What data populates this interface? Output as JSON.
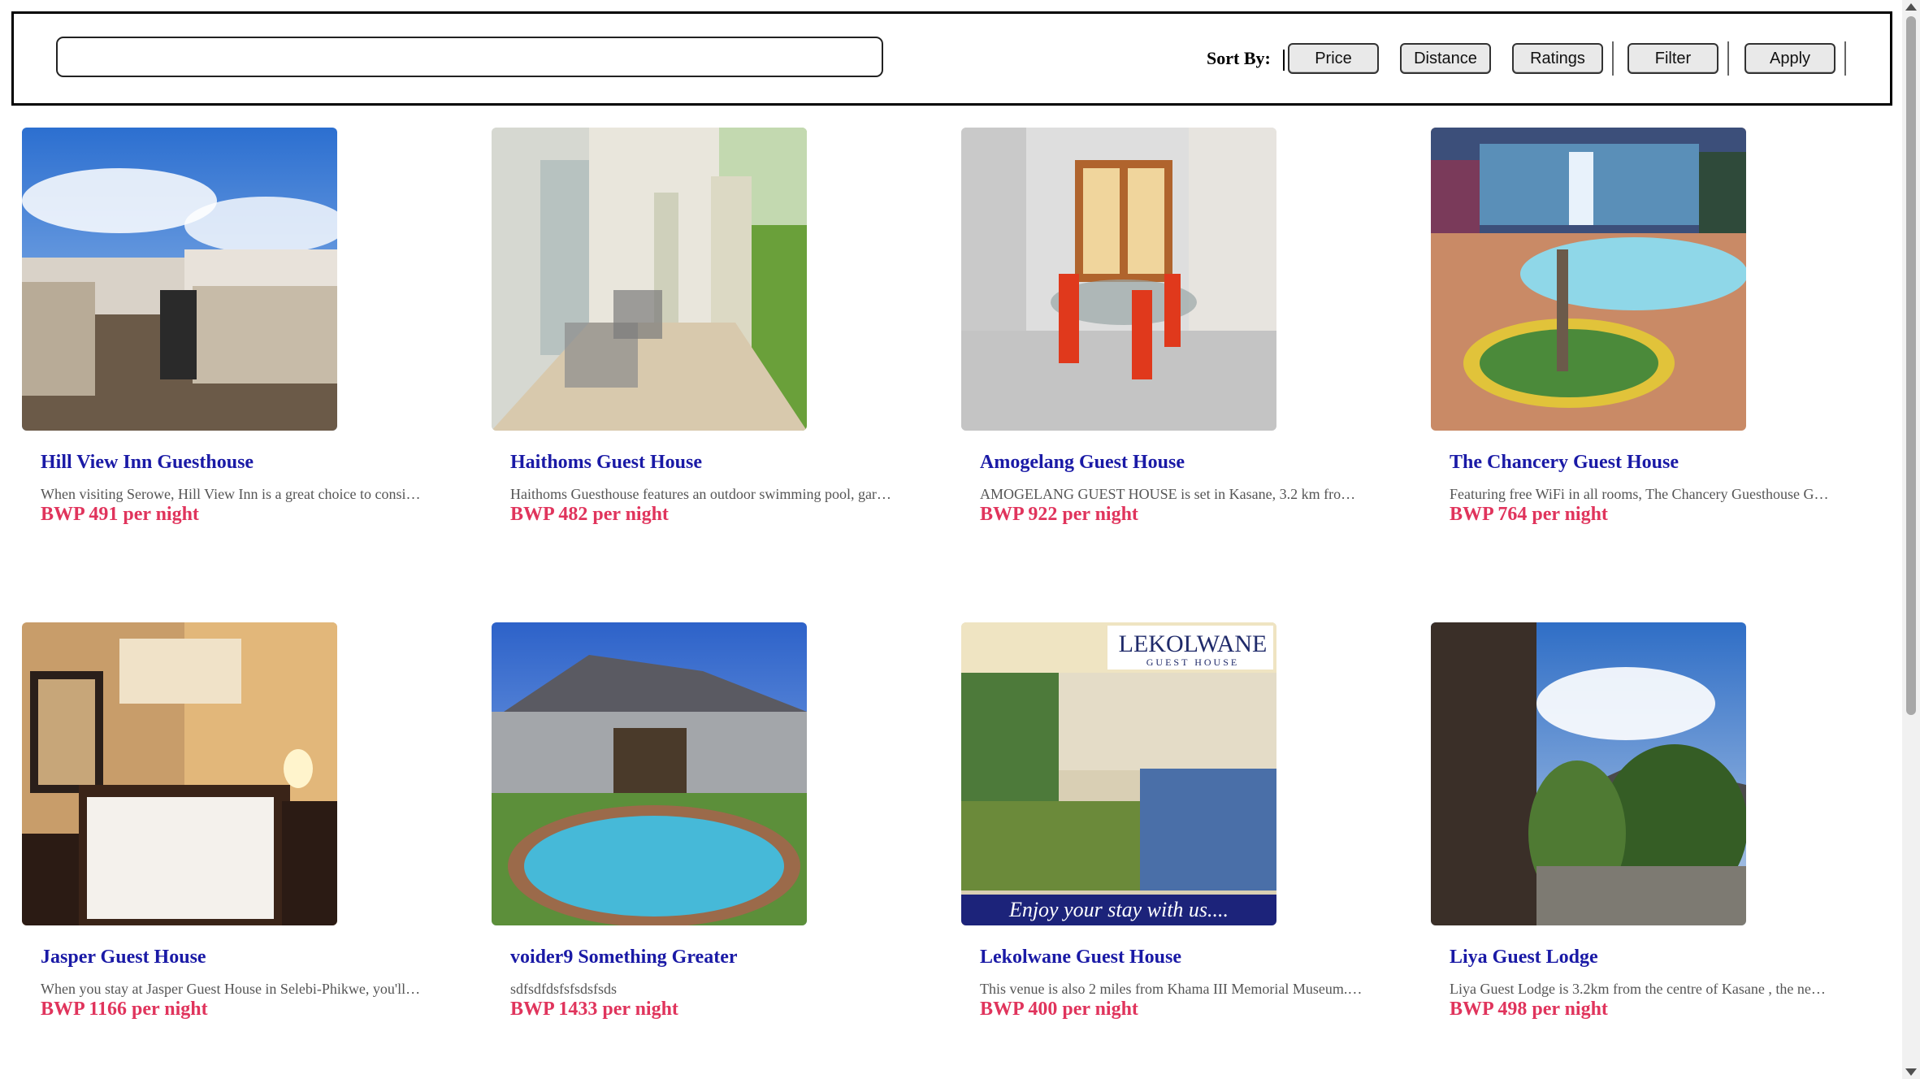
{
  "search": {
    "value": "",
    "placeholder": ""
  },
  "toolbar": {
    "sort_label": "Sort By:",
    "buttons": {
      "price": "Price",
      "distance": "Distance",
      "ratings": "Ratings",
      "filter": "Filter",
      "apply": "Apply"
    }
  },
  "listings": [
    {
      "title": "Hill View Inn Guesthouse",
      "description": "When visiting Serowe, Hill View Inn is a great choice to consi…",
      "price": "BWP 491 per night"
    },
    {
      "title": "Haithoms Guest House",
      "description": "Haithoms Guesthouse features an outdoor swimming pool, gar…",
      "price": "BWP 482 per night"
    },
    {
      "title": "Amogelang Guest House",
      "description": "AMOGELANG GUEST HOUSE is set in Kasane, 3.2 km fro…",
      "price": "BWP 922 per night"
    },
    {
      "title": "The Chancery Guest House",
      "description": "Featuring free WiFi in all rooms, The Chancery Guesthouse G…",
      "price": "BWP 764 per night"
    },
    {
      "title": "Jasper Guest House",
      "description": "When you stay at Jasper Guest House in Selebi-Phikwe, you'll…",
      "price": "BWP 1166 per night"
    },
    {
      "title": "voider9 Something Greater",
      "description": "sdfsdfdsfsfsdsfsds",
      "price": "BWP 1433 per night"
    },
    {
      "title": "Lekolwane Guest House",
      "description": "This venue is also 2 miles from Khama III Memorial Museum.…",
      "price": "BWP 400 per night"
    },
    {
      "title": "Liya Guest Lodge",
      "description": "Liya Guest Lodge is 3.2km from the centre of Kasane , the ne…",
      "price": "BWP 498 per night"
    }
  ],
  "photo_text": {
    "lekolwane_logo": "LEKOLWANE",
    "lekolwane_sub": "GUEST HOUSE",
    "lekolwane_slogan": "Enjoy your stay with us...."
  },
  "colors": {
    "title": "#1a1aa6",
    "price": "#e0345c",
    "description": "#555555"
  }
}
